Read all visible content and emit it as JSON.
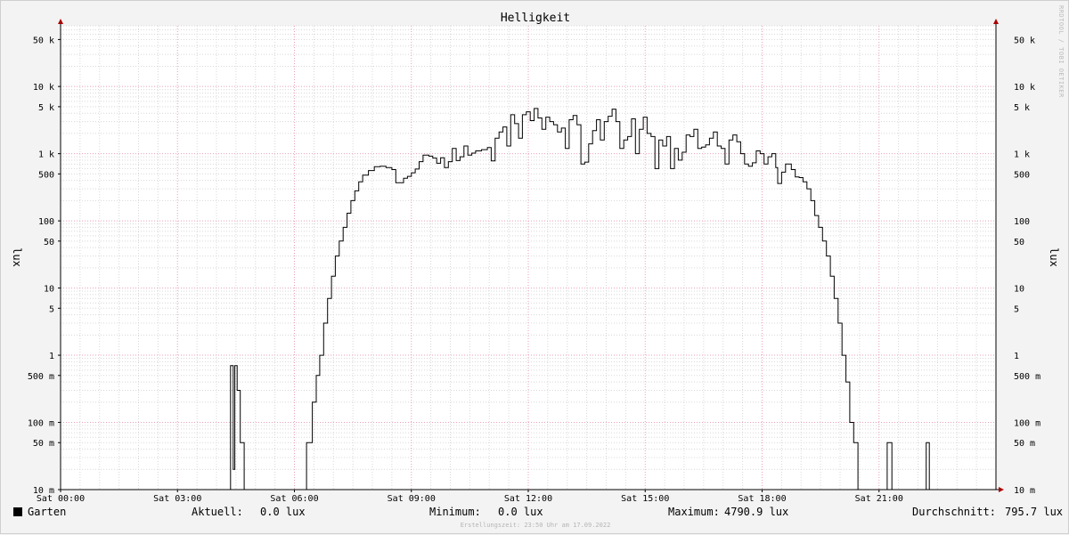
{
  "chart_data": {
    "type": "line",
    "title": "Helligkeit",
    "ylabel": "lux",
    "yscale": "log",
    "ylim": [
      0.01,
      80000
    ],
    "xlim": [
      0,
      24
    ],
    "grid": true,
    "x_tick_values": [
      0,
      3,
      6,
      9,
      12,
      15,
      18,
      21
    ],
    "x_tick_labels": [
      "Sat 00:00",
      "Sat 03:00",
      "Sat 06:00",
      "Sat 09:00",
      "Sat 12:00",
      "Sat 15:00",
      "Sat 18:00",
      "Sat 21:00"
    ],
    "y_tick_values": [
      0.01,
      0.05,
      0.1,
      0.5,
      1,
      5,
      10,
      50,
      100,
      500,
      1000,
      5000,
      10000,
      50000
    ],
    "y_tick_labels": [
      "10 m",
      "50 m",
      "100 m",
      "500 m",
      "1",
      "5",
      "10",
      "50",
      "100",
      "500",
      "1 k",
      "5 k",
      "10 k",
      "50 k"
    ],
    "series": [
      {
        "name": "Garten",
        "color": "#000000",
        "points": [
          [
            0,
            0.01
          ],
          [
            4.35,
            0.01
          ],
          [
            4.36,
            0.7
          ],
          [
            4.42,
            0.7
          ],
          [
            4.43,
            0.02
          ],
          [
            4.46,
            0.02
          ],
          [
            4.47,
            0.7
          ],
          [
            4.52,
            0.7
          ],
          [
            4.53,
            0.3
          ],
          [
            4.6,
            0.3
          ],
          [
            4.61,
            0.05
          ],
          [
            4.7,
            0.05
          ],
          [
            4.71,
            0.01
          ],
          [
            6.3,
            0.01
          ],
          [
            6.31,
            0.05
          ],
          [
            6.45,
            0.05
          ],
          [
            6.46,
            0.2
          ],
          [
            6.55,
            0.2
          ],
          [
            6.56,
            0.5
          ],
          [
            6.65,
            1
          ],
          [
            6.75,
            3
          ],
          [
            6.85,
            7
          ],
          [
            6.95,
            15
          ],
          [
            7.05,
            30
          ],
          [
            7.15,
            50
          ],
          [
            7.25,
            80
          ],
          [
            7.35,
            130
          ],
          [
            7.45,
            200
          ],
          [
            7.55,
            280
          ],
          [
            7.65,
            380
          ],
          [
            7.75,
            480
          ],
          [
            7.9,
            560
          ],
          [
            8.05,
            640
          ],
          [
            8.2,
            650
          ],
          [
            8.35,
            620
          ],
          [
            8.5,
            580
          ],
          [
            8.6,
            370
          ],
          [
            8.7,
            370
          ],
          [
            8.8,
            430
          ],
          [
            8.9,
            460
          ],
          [
            9.0,
            520
          ],
          [
            9.1,
            590
          ],
          [
            9.2,
            760
          ],
          [
            9.3,
            950
          ],
          [
            9.45,
            920
          ],
          [
            9.55,
            860
          ],
          [
            9.65,
            720
          ],
          [
            9.75,
            870
          ],
          [
            9.85,
            620
          ],
          [
            9.95,
            760
          ],
          [
            10.05,
            1200
          ],
          [
            10.15,
            790
          ],
          [
            10.25,
            900
          ],
          [
            10.35,
            1300
          ],
          [
            10.45,
            950
          ],
          [
            10.55,
            1020
          ],
          [
            10.65,
            1100
          ],
          [
            10.8,
            1150
          ],
          [
            10.95,
            1230
          ],
          [
            11.05,
            780
          ],
          [
            11.15,
            1700
          ],
          [
            11.25,
            2100
          ],
          [
            11.35,
            2500
          ],
          [
            11.45,
            1300
          ],
          [
            11.55,
            3800
          ],
          [
            11.65,
            2800
          ],
          [
            11.75,
            1700
          ],
          [
            11.85,
            3800
          ],
          [
            11.95,
            4200
          ],
          [
            12.05,
            3100
          ],
          [
            12.15,
            4700
          ],
          [
            12.25,
            3400
          ],
          [
            12.35,
            2300
          ],
          [
            12.45,
            3500
          ],
          [
            12.55,
            3000
          ],
          [
            12.65,
            2700
          ],
          [
            12.75,
            2100
          ],
          [
            12.85,
            2400
          ],
          [
            12.95,
            1200
          ],
          [
            13.05,
            3200
          ],
          [
            13.15,
            3700
          ],
          [
            13.25,
            2700
          ],
          [
            13.35,
            700
          ],
          [
            13.45,
            750
          ],
          [
            13.55,
            1400
          ],
          [
            13.65,
            2200
          ],
          [
            13.75,
            3200
          ],
          [
            13.85,
            1600
          ],
          [
            13.95,
            3000
          ],
          [
            14.05,
            3600
          ],
          [
            14.15,
            4600
          ],
          [
            14.25,
            3000
          ],
          [
            14.35,
            1200
          ],
          [
            14.45,
            1600
          ],
          [
            14.55,
            1800
          ],
          [
            14.65,
            3300
          ],
          [
            14.75,
            1000
          ],
          [
            14.85,
            2300
          ],
          [
            14.95,
            3500
          ],
          [
            15.05,
            2000
          ],
          [
            15.15,
            1800
          ],
          [
            15.25,
            600
          ],
          [
            15.35,
            1600
          ],
          [
            15.45,
            1300
          ],
          [
            15.55,
            1800
          ],
          [
            15.65,
            600
          ],
          [
            15.75,
            1200
          ],
          [
            15.85,
            800
          ],
          [
            15.95,
            1050
          ],
          [
            16.05,
            1900
          ],
          [
            16.15,
            1800
          ],
          [
            16.25,
            2300
          ],
          [
            16.35,
            1200
          ],
          [
            16.45,
            1250
          ],
          [
            16.55,
            1350
          ],
          [
            16.65,
            1700
          ],
          [
            16.75,
            2100
          ],
          [
            16.85,
            1300
          ],
          [
            16.95,
            1200
          ],
          [
            17.05,
            700
          ],
          [
            17.15,
            1600
          ],
          [
            17.25,
            1900
          ],
          [
            17.35,
            1500
          ],
          [
            17.45,
            1000
          ],
          [
            17.55,
            700
          ],
          [
            17.65,
            650
          ],
          [
            17.75,
            730
          ],
          [
            17.85,
            1100
          ],
          [
            17.95,
            1000
          ],
          [
            18.05,
            700
          ],
          [
            18.15,
            900
          ],
          [
            18.25,
            1000
          ],
          [
            18.35,
            620
          ],
          [
            18.4,
            360
          ],
          [
            18.5,
            530
          ],
          [
            18.6,
            700
          ],
          [
            18.75,
            580
          ],
          [
            18.85,
            450
          ],
          [
            18.95,
            440
          ],
          [
            19.05,
            380
          ],
          [
            19.15,
            300
          ],
          [
            19.25,
            200
          ],
          [
            19.35,
            120
          ],
          [
            19.45,
            80
          ],
          [
            19.55,
            50
          ],
          [
            19.65,
            30
          ],
          [
            19.75,
            15
          ],
          [
            19.85,
            7
          ],
          [
            19.95,
            3
          ],
          [
            20.05,
            1
          ],
          [
            20.15,
            0.4
          ],
          [
            20.25,
            0.1
          ],
          [
            20.35,
            0.05
          ],
          [
            20.45,
            0.05
          ],
          [
            20.46,
            0.01
          ],
          [
            21.2,
            0.01
          ],
          [
            21.21,
            0.05
          ],
          [
            21.32,
            0.05
          ],
          [
            21.33,
            0.01
          ],
          [
            22.2,
            0.01
          ],
          [
            22.21,
            0.05
          ],
          [
            22.28,
            0.05
          ],
          [
            22.29,
            0.01
          ],
          [
            24,
            0.01
          ]
        ]
      }
    ]
  },
  "legend": {
    "series_name": "Garten",
    "aktuell_label": "Aktuell:",
    "aktuell_value": "0.0 lux",
    "minimum_label": "Minimum:",
    "minimum_value": "0.0 lux",
    "maximum_label": "Maximum:",
    "maximum_value": "4790.9 lux",
    "avg_label": "Durchschnitt:",
    "avg_value": "795.7 lux"
  },
  "footer": "Erstellungszeit: 23:50 Uhr am 17.09.2022",
  "watermark": "RRDTOOL / TOBI OETIKER",
  "colors": {
    "background": "#f3f3f3",
    "plot_bg": "#ffffff",
    "major_grid": "#e8a0b4",
    "minor_grid": "#d8d8d8",
    "line": "#000000",
    "arrow": "#aa0000"
  }
}
